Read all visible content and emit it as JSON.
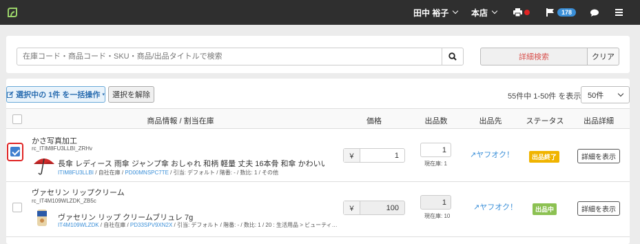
{
  "header": {
    "user": "田中 裕子",
    "store": "本店",
    "flag_count": "178"
  },
  "search": {
    "placeholder": "在庫コード・商品コード・SKU・商品/出品タイトルで検索",
    "advanced_label": "詳細検索",
    "clear_label": "クリア"
  },
  "toolbar": {
    "bulk_label": "選択中の 1件 を一括操作",
    "deselect_label": "選択を解除",
    "count_text": "55件中 1-50件 を表示",
    "per_page": "50件"
  },
  "columns": {
    "info": "商品情報 / 割当在庫",
    "price": "価格",
    "qty": "出品数",
    "dest": "出品先",
    "status": "ステータス",
    "detail": "出品詳細"
  },
  "rows": [
    {
      "checked": true,
      "title": "かさ写真加工",
      "code": "rc_ITIM8FU3LLBI_ZRHv",
      "product": "長傘 レディース 雨傘 ジャンプ傘 おしゃれ 和柄 軽量 丈夫 16本骨 和傘 かわいい 濡れると 猫…",
      "sku": "ITIM8FU3LLBI",
      "loc": "自社在庫",
      "pd": "PD00MNSPC7TE",
      "meta": "引当: デフォルト / 階番: - / 数比: 1 / その他",
      "price_sym": "￥",
      "price": "1",
      "qty": "1",
      "stock": "現在庫: 1",
      "dest": "ヤフオク！",
      "status": "出品終了",
      "status_color": "#f0b400",
      "detail": "詳細を表示"
    },
    {
      "checked": false,
      "title": "ヴァセリン リップクリーム",
      "code": "rc_IT4M109WLZDK_ZB5c",
      "product": "ヴァセリン リップ クリームブリュレ 7g",
      "sku": "IT4M109WLZDK",
      "loc": "自社在庫",
      "pd": "PD33SPV9XN2X",
      "meta": "引当: デフォルト / 階番: - / 数比: 1 / 20 : 生活用品 > ビューティ…",
      "price_sym": "￥",
      "price": "100",
      "qty": "1",
      "stock": "現在庫: 10",
      "dest": "ヤフオク！",
      "status": "出品中",
      "status_color": "#8cc152",
      "detail": "詳細を表示"
    }
  ]
}
